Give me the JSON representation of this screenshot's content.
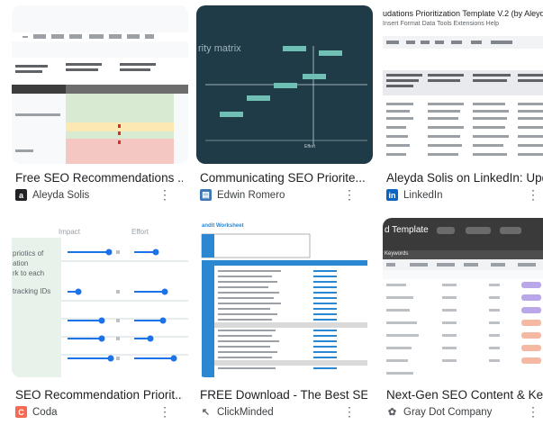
{
  "results": [
    {
      "title": "Free SEO Recommendations ...",
      "source": "Aleyda Solis",
      "favicon": "aleyda-icon",
      "more": "⋮"
    },
    {
      "title": "Communicating SEO Priorite...",
      "source": "Edwin Romero",
      "favicon": "edwin-icon",
      "more": "⋮"
    },
    {
      "title": "Aleyda Solis on LinkedIn: Upd...",
      "source": "LinkedIn",
      "favicon": "linkedin-icon",
      "more": "⋮"
    },
    {
      "title": "SEO Recommendation Priorit...",
      "source": "Coda",
      "favicon": "coda-icon",
      "more": "⋮"
    },
    {
      "title": "FREE Download - The Best SE...",
      "source": "ClickMinded",
      "favicon": "clickminded-icon",
      "more": "⋮"
    },
    {
      "title": "Next-Gen SEO Content & Key...",
      "source": "Gray Dot Company",
      "favicon": "graydot-icon",
      "more": "⋮"
    }
  ],
  "thumb_text": {
    "priority_matrix_title": "rity matrix",
    "effort_label": "Effort",
    "template_title": "udations Prioritization Template V.2 (by Aleyda",
    "template_menu": "Insert   Format   Data   Tools   Extensions   Help",
    "coda_impact": "Impact",
    "coda_effort": "Effort",
    "coda_row_text_1": "priotics of",
    "coda_row_text_2": "ation",
    "coda_row_text_3": "rk to each",
    "coda_row_text_4": "tracking IDs",
    "click_title": "andit Worksheet",
    "graydot_title": "d Template",
    "graydot_tab": "Keywords"
  },
  "colors": {
    "matrix_bg": "#1f3b47",
    "matrix_box": "#6fbfb4",
    "coda_bg": "#e9f3ee",
    "coda_green": "#cde6d3",
    "clickminded_blue": "#2b87d1",
    "graydot_dark": "#3a3a3a",
    "graydot_purple": "#b9a7e9"
  }
}
